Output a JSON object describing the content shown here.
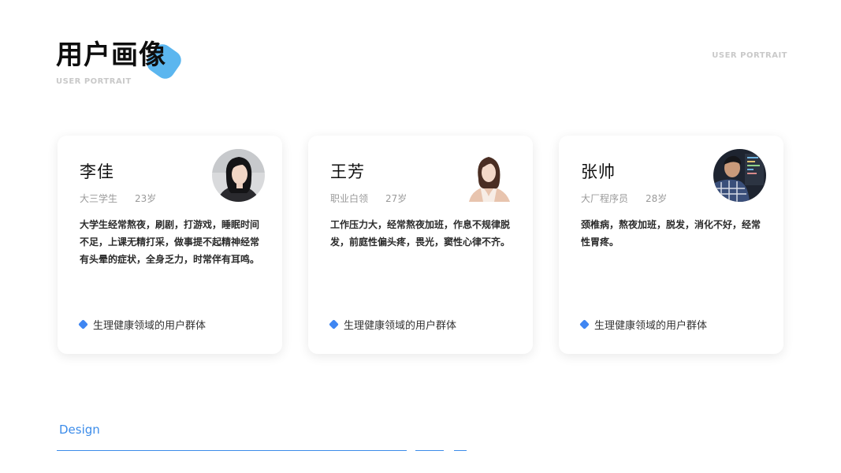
{
  "header": {
    "title": "用户画像",
    "subtitle": "USER PORTRAIT",
    "corner_label": "USER PORTRAIT",
    "accent_color": "#5bb6ef"
  },
  "cards": [
    {
      "name": "李佳",
      "role": "大三学生",
      "age": "23岁",
      "description": "大学生经常熬夜，刷剧，打游戏，睡眠时间不足，上课无精打采，做事提不起精神经常有头晕的症状，全身乏力，时常伴有耳鸣。",
      "tag": "生理健康领域的用户群体",
      "avatar_icon": "woman-portrait-icon"
    },
    {
      "name": "王芳",
      "role": "职业白领",
      "age": "27岁",
      "description": "工作压力大，经常熬夜加班，作息不规律脱发，前庭性偏头疼，畏光，窦性心律不齐。",
      "tag": "生理健康领域的用户群体",
      "avatar_icon": "woman-portrait-icon"
    },
    {
      "name": "张帅",
      "role": "大厂程序员",
      "age": "28岁",
      "description": "颈椎病，熬夜加班，脱发，消化不好，经常性胃疼。",
      "tag": "生理健康领域的用户群体",
      "avatar_icon": "man-portrait-icon"
    }
  ],
  "footer": {
    "label": "Design",
    "line_color": "#3c8cea"
  },
  "colors": {
    "tag_diamond": "#3f86f2",
    "muted_text": "#9a9a9a"
  }
}
